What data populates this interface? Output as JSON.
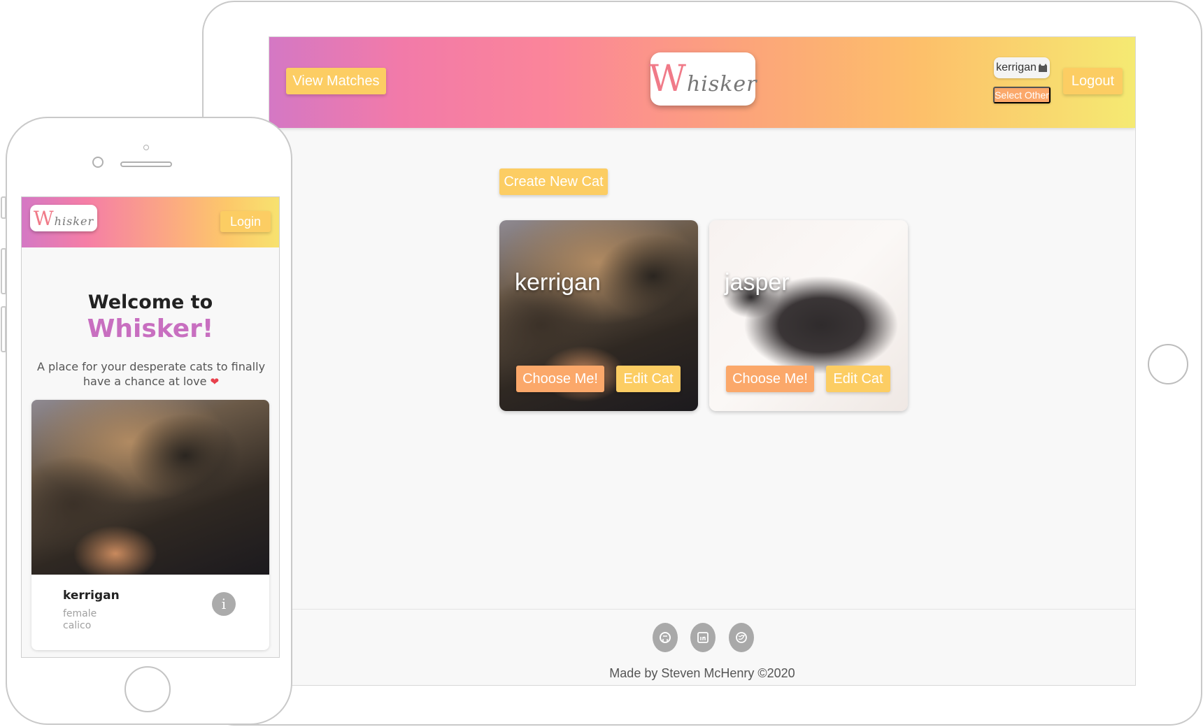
{
  "desktop": {
    "header": {
      "view_matches_label": "View Matches",
      "logo_w": "W",
      "logo_rest": "hisker",
      "selected_cat": "kerrigan",
      "selected_cat_icon": "cat-icon",
      "select_other_label": "Select Other",
      "logout_label": "Logout"
    },
    "create_cat_label": "Create New Cat",
    "cats": [
      {
        "name": "kerrigan",
        "choose_label": "Choose Me!",
        "edit_label": "Edit Cat"
      },
      {
        "name": "jasper",
        "choose_label": "Choose Me!",
        "edit_label": "Edit Cat"
      }
    ],
    "footer": {
      "icons": [
        "github-icon",
        "linkedin-icon",
        "twitter-icon"
      ],
      "credit": "Made by Steven McHenry ©2020"
    }
  },
  "mobile": {
    "header": {
      "logo_w": "W",
      "logo_rest": "hisker",
      "login_label": "Login"
    },
    "welcome": "Welcome to",
    "brand": "Whisker!",
    "tagline": "A place for your desperate cats to finally have a chance at love",
    "heart": "❤",
    "card": {
      "name": "kerrigan",
      "gender": "female",
      "breed": "calico",
      "info_glyph": "i"
    }
  },
  "colors": {
    "accent_yellow": "#fccd63",
    "accent_peach": "#fba86a",
    "brand_purple": "#c86fc0",
    "heart_red": "#e8404c"
  }
}
